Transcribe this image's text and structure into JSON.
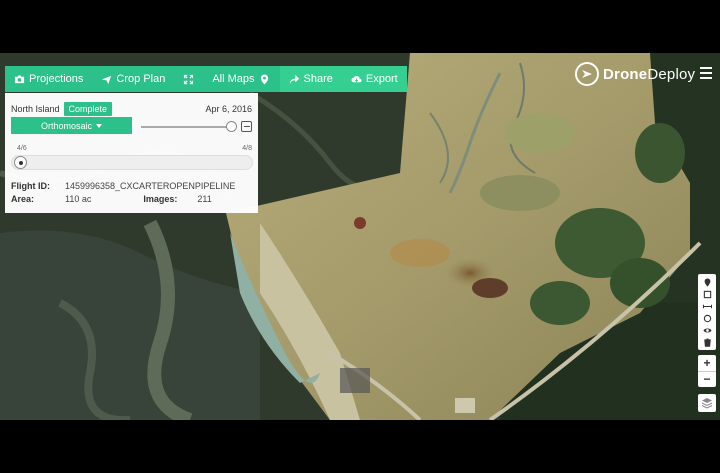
{
  "toolbar": {
    "projections": "Projections",
    "crop_plan": "Crop Plan",
    "all_maps": "All Maps",
    "share": "Share",
    "export": "Export"
  },
  "logo": {
    "bold": "Drone",
    "light": "Deploy"
  },
  "panel": {
    "site_name": "North Island",
    "status": "Complete",
    "date": "Apr 6, 2016",
    "layer": "Orthomosaic",
    "timeline_start": "4/6",
    "timeline_end": "4/8",
    "flight_id_label": "Flight ID:",
    "flight_id": "1459996358_CXCARTEROPENPIPELINE",
    "area_label": "Area:",
    "area": "110 ac",
    "images_label": "Images:",
    "images": "211"
  },
  "zoom": {
    "in": "+",
    "out": "−"
  },
  "colors": {
    "accent": "#2cc08a",
    "accent_alt": "#35cf92"
  }
}
